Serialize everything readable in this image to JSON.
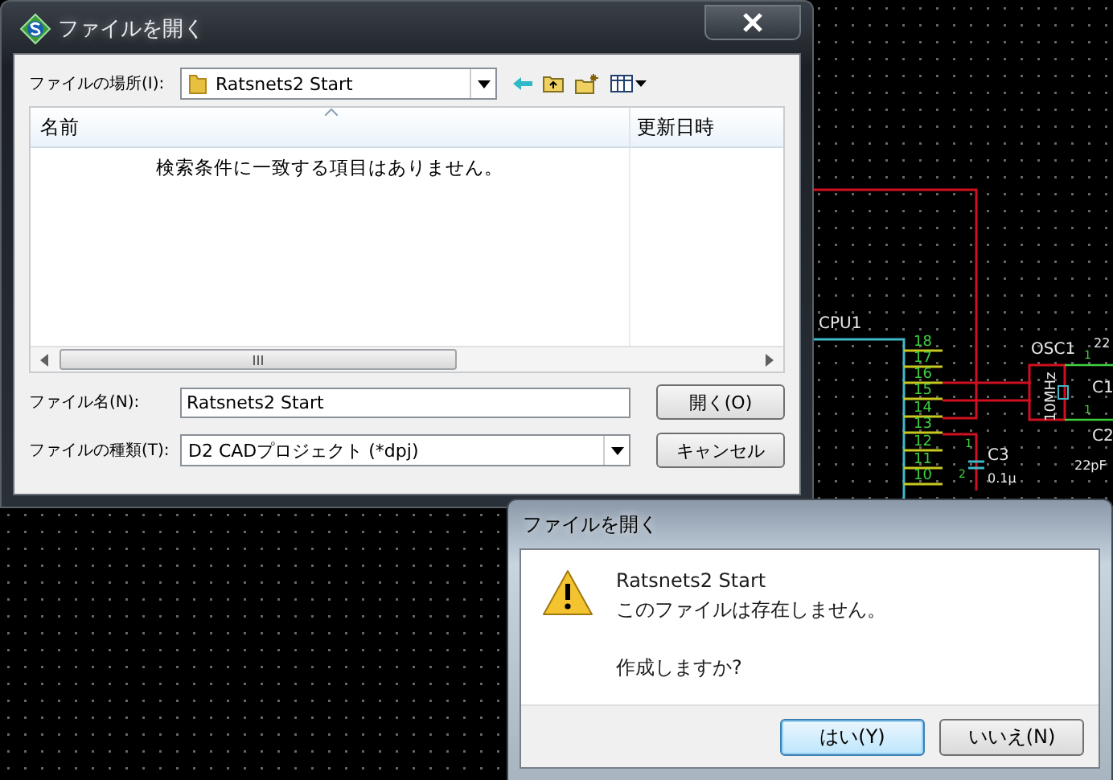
{
  "schematic": {
    "component_label": "CPU1",
    "pins": [
      "18",
      "17",
      "16",
      "15",
      "14",
      "13",
      "12",
      "11",
      "10"
    ],
    "oscillator_label": "OSC1",
    "oscillator_value": "10MHz",
    "capacitor_labels": [
      "C1",
      "C2",
      "C3"
    ],
    "capacitor_values": [
      "22",
      "22pF",
      "0.1μ"
    ],
    "pin_marks": [
      "1",
      "1",
      "1",
      "2"
    ]
  },
  "open_dialog": {
    "title": "ファイルを開く",
    "location_label": "ファイルの場所(I):",
    "location_value": "Ratsnets2 Start",
    "columns": [
      "名前",
      "更新日時"
    ],
    "empty_message": "検索条件に一致する項目はありません。",
    "filename_label": "ファイル名(N):",
    "filename_value": "Ratsnets2 Start",
    "filetype_label": "ファイルの種類(T):",
    "filetype_value": "D2 CADプロジェクト (*dpj)",
    "buttons": [
      "開く(O)",
      "キャンセル"
    ]
  },
  "confirm_dialog": {
    "title": "ファイルを開く",
    "file_name": "Ratsnets2 Start",
    "message": "このファイルは存在しません。",
    "question": "作成しますか?",
    "buttons": [
      {
        "label": "はい(Y)",
        "selected": true
      },
      {
        "label": "いいえ(N)",
        "selected": false
      }
    ]
  }
}
